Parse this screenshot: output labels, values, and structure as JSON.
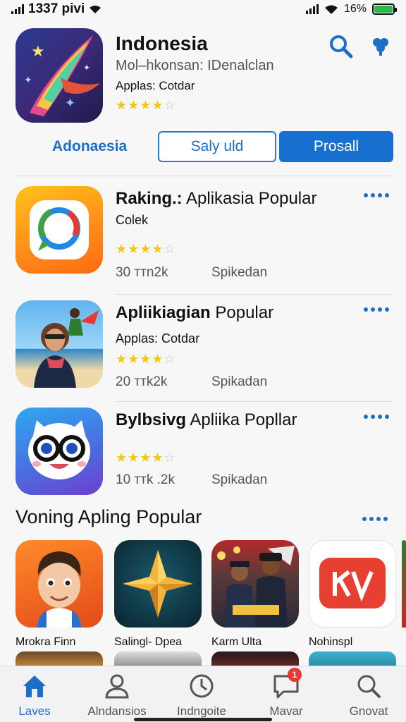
{
  "status_bar": {
    "time": "1337 pivi",
    "battery": "16%"
  },
  "hero": {
    "title": "Indonesia",
    "subtitle": "Mol–hkonsan: IDenalclan",
    "meta": "Applas: Cotdar",
    "rating": 4
  },
  "tabs": [
    {
      "label": "Adonaesia"
    },
    {
      "label": "Saly uld"
    },
    {
      "label": "Prosall"
    }
  ],
  "apps": [
    {
      "title_bold": "Raking.:",
      "title_rest": " Aplikasia Popular",
      "sub": "Colek",
      "rating": 4,
      "stat": "30 ттn2k",
      "label": "Spikedan"
    },
    {
      "title_bold": "Apliikiagian",
      "title_rest": " Popular",
      "sub": "Applas: Cotdar",
      "rating": 4,
      "stat": "20 ттk2k",
      "label": "Spikadan"
    },
    {
      "title_bold": "Bylbsivg",
      "title_rest": " Apliika Popllar",
      "sub": "",
      "rating": 4,
      "stat": "10 ттk .2k",
      "label": "Spikadan"
    }
  ],
  "section": {
    "title": "Voning Apling Popular"
  },
  "grid": [
    {
      "label": "Mrokra Finn"
    },
    {
      "label": "Salingl- Dpea"
    },
    {
      "label": "Karm Ulta"
    },
    {
      "label": "Nohinspl"
    }
  ],
  "tab_bar": [
    {
      "label": "Laves",
      "icon": "home-icon"
    },
    {
      "label": "Alndansios",
      "icon": "person-icon"
    },
    {
      "label": "Indngoite",
      "icon": "clock-icon"
    },
    {
      "label": "Mavar",
      "icon": "chat-icon",
      "badge": "1"
    },
    {
      "label": "Gnovat",
      "icon": "search-icon"
    }
  ],
  "colors": {
    "accent": "#1c6fc9",
    "star": "#f5c518"
  }
}
